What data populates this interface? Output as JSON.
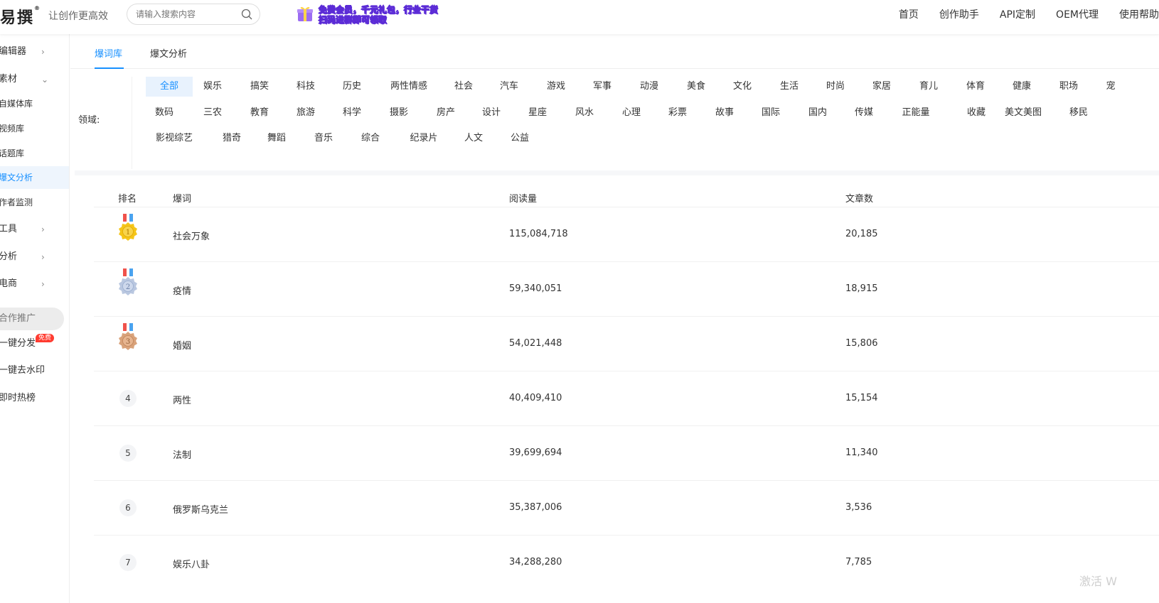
{
  "header": {
    "logo_text": "易撰",
    "logo_mark": "®",
    "slogan": "让创作更高效",
    "search_placeholder": "请输入搜索内容",
    "promo_line1": "免费会员，千元礼包，行业干货",
    "promo_line2": "扫码进群即可领取",
    "nav": [
      "首页",
      "创作助手",
      "API定制",
      "OEM代理",
      "使用帮助"
    ]
  },
  "sidebar": {
    "editor": "编辑器",
    "materials": "素材",
    "self_media": "自媒体库",
    "video": "视频库",
    "topics": "话题库",
    "hot_analysis": "爆文分析",
    "author_monitor": "作者监测",
    "tools": "工具",
    "analysis": "分析",
    "ecommerce": "电商",
    "cooperation": "合作推广",
    "one_click_publish": "一键分发",
    "free_badge": "免费",
    "remove_watermark": "一键去水印",
    "realtime_hot": "即时热榜"
  },
  "tabs": [
    "爆词库",
    "爆文分析"
  ],
  "domain": {
    "label": "领域:",
    "row1": [
      "全部",
      "娱乐",
      "搞笑",
      "科技",
      "历史",
      "两性情感",
      "社会",
      "汽车",
      "游戏",
      "军事",
      "动漫",
      "美食",
      "文化",
      "生活",
      "时尚",
      "家居",
      "育儿",
      "体育",
      "健康",
      "职场",
      "宠"
    ],
    "row2": [
      "数码",
      "三农",
      "教育",
      "旅游",
      "科学",
      "摄影",
      "房产",
      "设计",
      "星座",
      "风水",
      "心理",
      "彩票",
      "故事",
      "国际",
      "国内",
      "传媒",
      "正能量",
      "收藏",
      "美文美图",
      "移民"
    ],
    "row3": [
      "影视综艺",
      "猎奇",
      "舞蹈",
      "音乐",
      "综合",
      "纪录片",
      "人文",
      "公益"
    ]
  },
  "table": {
    "headers": [
      "排名",
      "爆词",
      "阅读量",
      "文章数"
    ],
    "rows": [
      {
        "rank": "1",
        "word": "社会万象",
        "reads": "115,084,718",
        "articles": "20,185"
      },
      {
        "rank": "2",
        "word": "疫情",
        "reads": "59,340,051",
        "articles": "18,915"
      },
      {
        "rank": "3",
        "word": "婚姻",
        "reads": "54,021,448",
        "articles": "15,806"
      },
      {
        "rank": "4",
        "word": "两性",
        "reads": "40,409,410",
        "articles": "15,154"
      },
      {
        "rank": "5",
        "word": "法制",
        "reads": "39,699,694",
        "articles": "11,340"
      },
      {
        "rank": "6",
        "word": "俄罗斯乌克兰",
        "reads": "35,387,006",
        "articles": "3,536"
      },
      {
        "rank": "7",
        "word": "娱乐八卦",
        "reads": "34,288,280",
        "articles": "7,785"
      }
    ]
  },
  "watermark": "激活 W",
  "colors": {
    "accent": "#1890ff",
    "gold": "#f5c518",
    "silver": "#b9c7e0",
    "bronze": "#d9a27a",
    "ribbon_red": "#f0524b",
    "ribbon_blue": "#4aa3f0"
  }
}
